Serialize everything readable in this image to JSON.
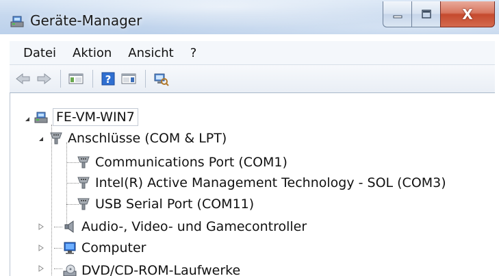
{
  "window": {
    "title": "Geräte-Manager",
    "close_glyph": "X"
  },
  "menu": [
    "Datei",
    "Aktion",
    "Ansicht",
    "?"
  ],
  "toolbar": {
    "buttons": [
      "back-icon",
      "forward-icon",
      "show-hide-console-tree-icon",
      "help-icon",
      "properties-pane-icon",
      "scan-hardware-icon"
    ]
  },
  "tree": {
    "root": "FE-VM-WIN7",
    "ports_category": "Anschlüsse (COM & LPT)",
    "ports": [
      "Communications Port (COM1)",
      "Intel(R) Active Management Technology - SOL (COM3)",
      "USB Serial Port (COM11)"
    ],
    "audio_category": "Audio-, Video- und Gamecontroller",
    "computer_category": "Computer",
    "dvd_category": "DVD/CD-ROM-Laufwerke"
  },
  "colors": {
    "titlebar": "#c6d8ee",
    "close_button": "#c54a2e",
    "selection_border": "#c3cad4"
  }
}
